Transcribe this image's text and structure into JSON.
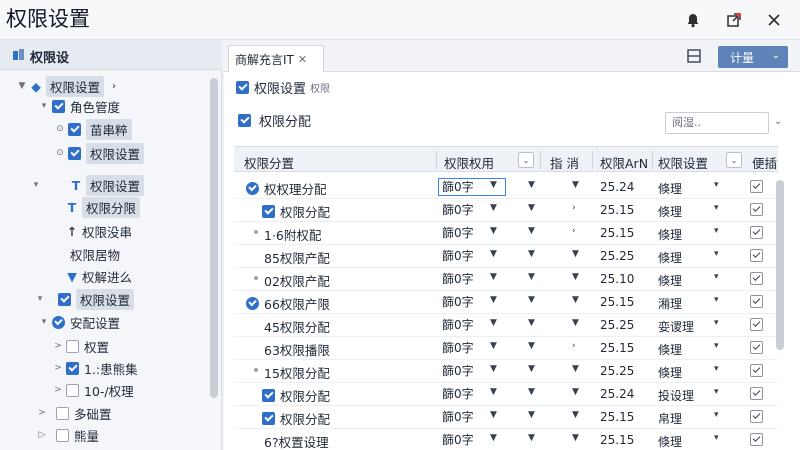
{
  "window": {
    "title": "权限设置"
  },
  "left_panel": {
    "header": "权限设",
    "tree": [
      {
        "label": "权限设置",
        "highlight": true
      },
      {
        "label": "角色管度"
      },
      {
        "label": "苗串粹",
        "highlight": true
      },
      {
        "label": "权限设置",
        "highlight": false
      },
      {
        "label": "权限设置",
        "highlight": true
      },
      {
        "label": "权限分限",
        "highlight": true
      },
      {
        "label": "权限没串"
      },
      {
        "label": "权限居物"
      },
      {
        "label": "权解进么"
      },
      {
        "label": "权限设置",
        "highlight": true
      },
      {
        "label": "安配设置"
      },
      {
        "label": "权置"
      },
      {
        "label": "1.:患熊集"
      },
      {
        "label": "10-/权理"
      },
      {
        "label": "多础置"
      },
      {
        "label": "熊量"
      }
    ]
  },
  "right_panel": {
    "tab": {
      "label": "商解充言IT"
    },
    "top_select": "计量",
    "option1": {
      "label": "权限设置",
      "sub": "权限"
    },
    "option2": {
      "label": "权限分配"
    },
    "search_placeholder": "阅湿..",
    "columns": [
      "权限分置",
      "权限权用",
      "指 消",
      "权限ArN",
      "权限设置",
      "便插"
    ],
    "rows": [
      {
        "name": "权权理分配",
        "value": "篩0字",
        "num": "25.24",
        "mode": "倏理"
      },
      {
        "name": "权限分配",
        "value": "篩0字",
        "num": "25.15",
        "mode": "倏理"
      },
      {
        "name": "1·6附权配",
        "value": "篩0字",
        "num": "25.15",
        "mode": "倏理"
      },
      {
        "name": "85权限产配",
        "value": "篩0字",
        "num": "25.25",
        "mode": "倏理"
      },
      {
        "name": "02权限产配",
        "value": "篩0字",
        "num": "25.10",
        "mode": "倏理"
      },
      {
        "name": "66权限产限",
        "value": "篩0字",
        "num": "25.15",
        "mode": "潲理"
      },
      {
        "name": "45权限分配",
        "value": "篩0字",
        "num": "25.25",
        "mode": "娈谡理"
      },
      {
        "name": "63权限播限",
        "value": "篩0字",
        "num": "25.15",
        "mode": "倏理"
      },
      {
        "name": "15权限分配",
        "value": "篩0字",
        "num": "25.25",
        "mode": "倏理"
      },
      {
        "name": "权限分配",
        "value": "篩0字",
        "num": "25.24",
        "mode": "投设理"
      },
      {
        "name": "权限分配",
        "value": "篩0字",
        "num": "25.15",
        "mode": "帛理"
      },
      {
        "name": "6?权置设理",
        "value": "篩0字",
        "num": "25.15",
        "mode": "倏理"
      }
    ]
  }
}
